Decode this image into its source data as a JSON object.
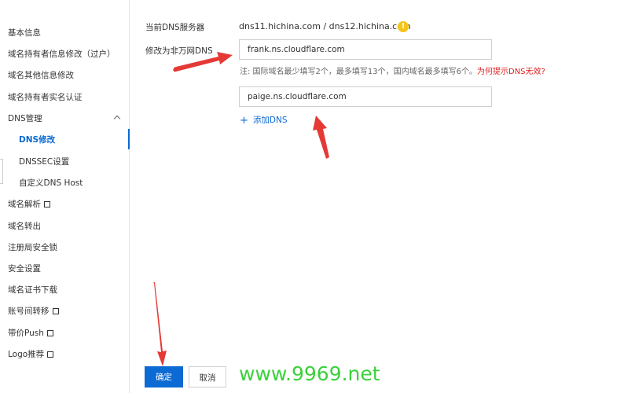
{
  "sidebar": {
    "items": [
      {
        "label": "基本信息"
      },
      {
        "label": "域名持有者信息修改（过户）"
      },
      {
        "label": "域名其他信息修改"
      },
      {
        "label": "域名持有者实名认证"
      },
      {
        "label": "DNS管理"
      },
      {
        "label": "DNS修改"
      },
      {
        "label": "DNSSEC设置"
      },
      {
        "label": "自定义DNS Host"
      },
      {
        "label": "域名解析"
      },
      {
        "label": "域名转出"
      },
      {
        "label": "注册局安全锁"
      },
      {
        "label": "安全设置"
      },
      {
        "label": "域名证书下载"
      },
      {
        "label": "账号间转移"
      },
      {
        "label": "带价Push"
      },
      {
        "label": "Logo推荐"
      }
    ]
  },
  "form": {
    "current_dns_label": "当前DNS服务器",
    "current_dns_value": "dns11.hichina.com / dns12.hichina.com",
    "warning_icon": "!",
    "change_dns_label": "修改为非万网DNS",
    "dns1_value": "frank.ns.cloudflare.com",
    "dns2_value": "paige.ns.cloudflare.com",
    "note_text": "注:  国际域名最少填写2个，最多填写13个，国内域名最多填写6个。",
    "note_link": "为何提示DNS无效?",
    "add_dns_label": "添加DNS"
  },
  "buttons": {
    "confirm": "确定",
    "cancel": "取消"
  },
  "watermark": "www.9969.net",
  "colors": {
    "accent": "#0b6ad3",
    "arrow": "#e53935",
    "warning": "#f5c518",
    "watermark": "#3bd13b"
  }
}
